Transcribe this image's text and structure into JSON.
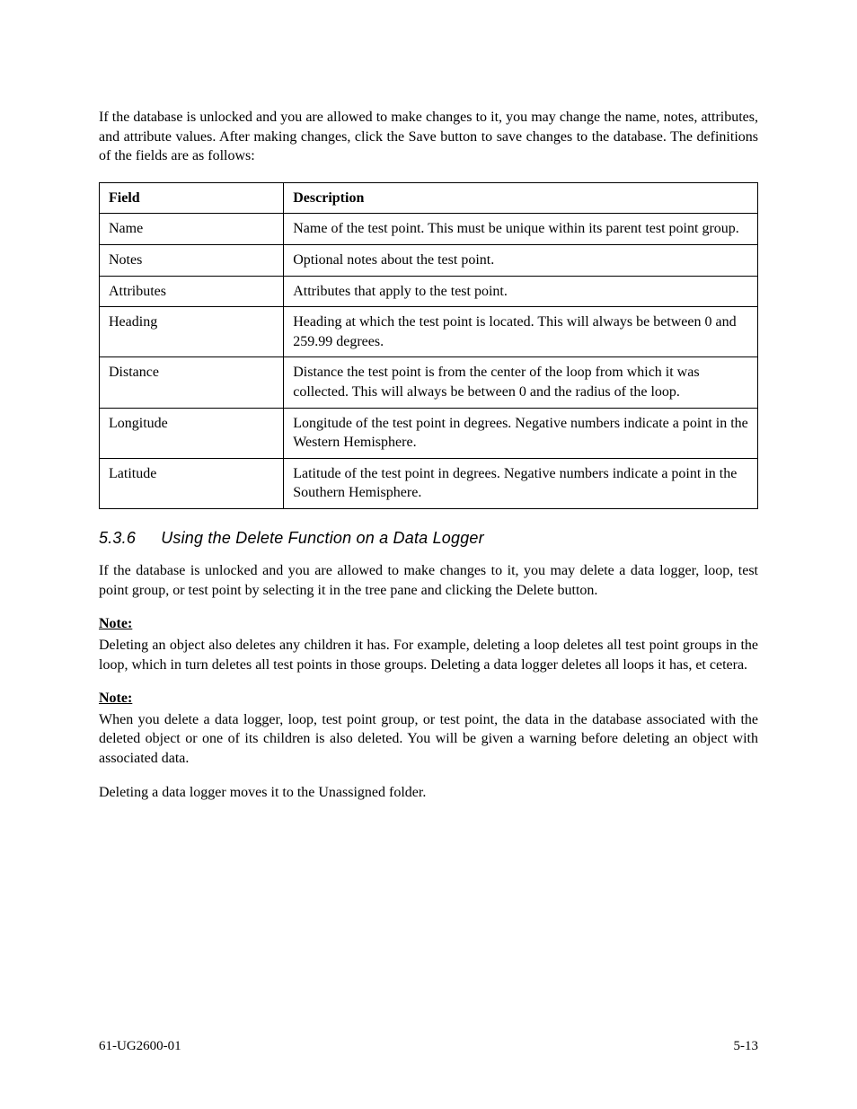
{
  "intro": {
    "p1": "If the database is unlocked and you are allowed to make changes to it, you may change the name, notes, attributes, and attribute values. After making changes, click the Save button to save changes to the database. The definitions of the fields are as follows:"
  },
  "table": {
    "header_field": "Field",
    "header_desc": "Description",
    "rows": [
      {
        "field": "Name",
        "desc": "Name of the test point. This must be unique within its parent test point group."
      },
      {
        "field": "Notes",
        "desc": "Optional notes about the test point."
      },
      {
        "field": "Attributes",
        "desc": "Attributes that apply to the test point."
      },
      {
        "field": "Heading",
        "desc": "Heading at which the test point is located. This will always be between 0 and 259.99 degrees."
      },
      {
        "field": "Distance",
        "desc": "Distance the test point is from the center of the loop from which it was collected. This will always be between 0 and the radius of the loop."
      },
      {
        "field": "Longitude",
        "desc": "Longitude of the test point in degrees. Negative numbers indicate a point in the Western Hemisphere."
      },
      {
        "field": "Latitude",
        "desc": "Latitude of the test point in degrees. Negative numbers indicate a point in the Southern Hemisphere."
      }
    ]
  },
  "section": {
    "number": "5.3.6",
    "title": "Using the Delete Function on a Data Logger"
  },
  "body": {
    "p1": "If the database is unlocked and you are allowed to make changes to it, you may delete a data logger, loop, test point group, or test point by selecting it in the tree pane and clicking the Delete button.",
    "note1_label": "Note:",
    "note1_text": "Deleting an object also deletes any children it has. For example, deleting a loop deletes all test point groups in the loop, which in turn deletes all test points in those groups. Deleting a data logger deletes all loops it has, et cetera.",
    "note2_label": "Note:",
    "note2_text": "When you delete a data logger, loop, test point group, or test point, the data in the database associated with the deleted object or one of its children is also deleted. You will be given a warning before deleting an object with associated data.",
    "p2": "Deleting a data logger moves it to the Unassigned folder."
  },
  "footer": {
    "left": "61-UG2600-01",
    "right": "5-13"
  }
}
